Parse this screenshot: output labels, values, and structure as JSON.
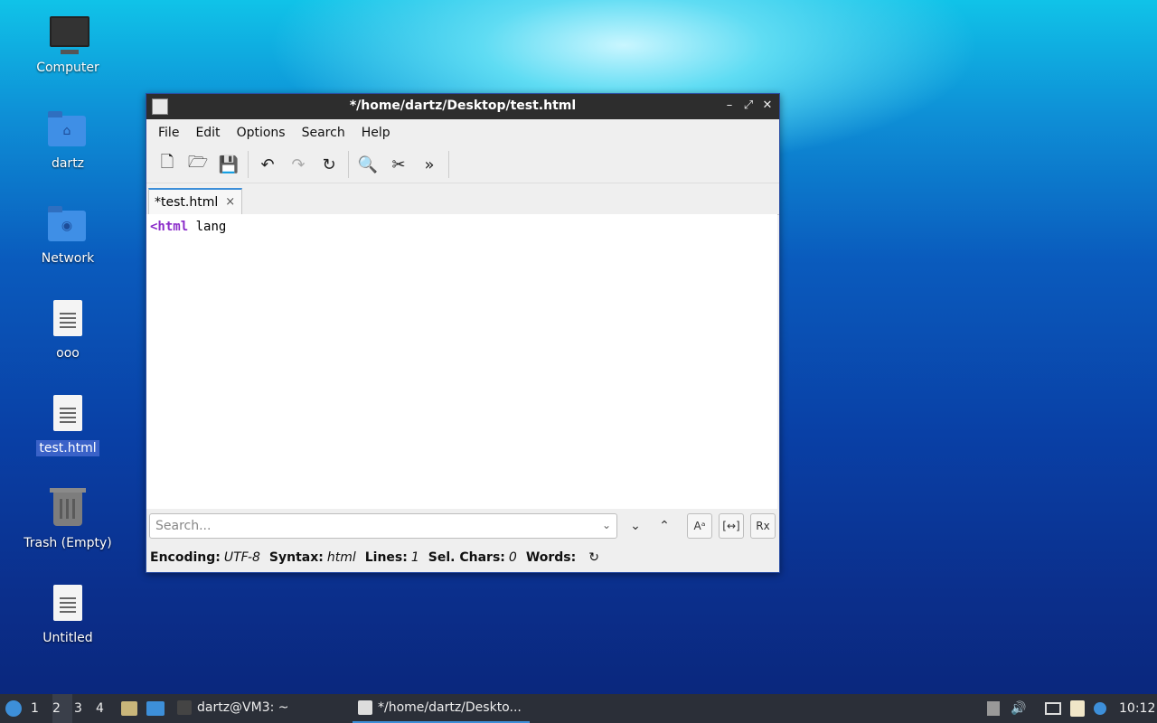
{
  "desktop": {
    "icons": [
      {
        "label": "Computer",
        "icon": "computer-icon"
      },
      {
        "label": "dartz",
        "icon": "home-folder-icon"
      },
      {
        "label": "Network",
        "icon": "network-folder-icon"
      },
      {
        "label": "ooo",
        "icon": "text-file-icon"
      },
      {
        "label": "test.html",
        "icon": "text-file-icon",
        "selected": true
      },
      {
        "label": "Trash (Empty)",
        "icon": "trash-icon"
      },
      {
        "label": "Untitled",
        "icon": "text-file-icon"
      }
    ]
  },
  "window": {
    "title": "*/home/dartz/Desktop/test.html",
    "controls": {
      "minimize": "–",
      "maximize": "⤢",
      "close": "✕"
    },
    "menu": [
      "File",
      "Edit",
      "Options",
      "Search",
      "Help"
    ],
    "toolbar": [
      {
        "name": "new-file",
        "glyph": "🗋"
      },
      {
        "name": "open-file",
        "glyph": "🗁"
      },
      {
        "name": "save-file",
        "glyph": "💾"
      },
      {
        "name": "undo",
        "glyph": "↶"
      },
      {
        "name": "redo",
        "glyph": "↷"
      },
      {
        "name": "reload",
        "glyph": "↻"
      },
      {
        "name": "find",
        "glyph": "🔍"
      },
      {
        "name": "replace",
        "glyph": "✂"
      },
      {
        "name": "more",
        "glyph": "»"
      }
    ],
    "tab": {
      "label": "*test.html",
      "close": "×"
    },
    "editor": {
      "keyword": "<html",
      "rest": " lang"
    },
    "search": {
      "placeholder": "Search...",
      "dropdown": "⌄",
      "down": "⌄",
      "up": "⌃",
      "opt_case": "Aᵃ",
      "opt_whole": "[↔]",
      "opt_regex": "Rx"
    },
    "status": {
      "encoding_label": "Encoding:",
      "encoding": "UTF-8",
      "syntax_label": "Syntax:",
      "syntax": "html",
      "lines_label": "Lines:",
      "lines": "1",
      "sel_label": "Sel. Chars:",
      "sel": "0",
      "words_label": "Words:",
      "refresh": "↻"
    }
  },
  "taskbar": {
    "workspaces": [
      "1",
      "2",
      "3",
      "4"
    ],
    "active_workspace": "2",
    "tasks": [
      {
        "label": "dartz@VM3: ~"
      },
      {
        "label": "*/home/dartz/Deskto..."
      }
    ],
    "clock": "10:12"
  }
}
